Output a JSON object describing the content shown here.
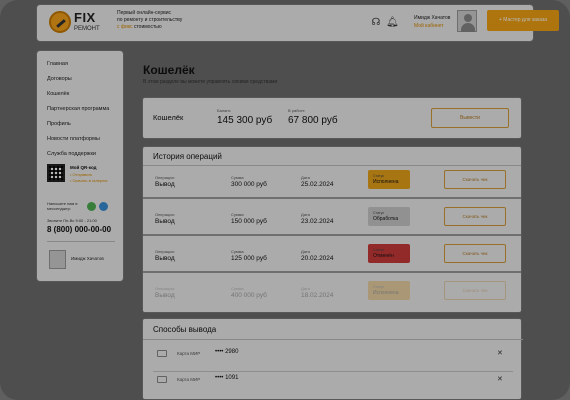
{
  "header": {
    "logo_top": "FIX",
    "logo_bottom": "РЕМОНТ",
    "tagline_line1": "Первый онлайн-сервис",
    "tagline_line2": "по ремонту и строительству",
    "tagline_accent": "с фикс",
    "tagline_rest": "стоимостью",
    "user_name": "Имидж Хачатов",
    "user_role": "Мой кабинет",
    "action_button": "+ Мастер для заказа"
  },
  "sidebar": {
    "items": [
      {
        "label": "Главная"
      },
      {
        "label": "Договоры"
      },
      {
        "label": "Кошелёк"
      },
      {
        "label": "Партнерская программа"
      },
      {
        "label": "Профиль"
      },
      {
        "label": "Новости платформы"
      },
      {
        "label": "Служба поддержки"
      }
    ],
    "qr_title": "Мой QR-код",
    "qr_link1": "• Отправить",
    "qr_link2": "• Скачать в галерею",
    "messengers_label": "Напишите нам в мессенджер:",
    "hours": "Звоните Пн-Вс 9:00 - 21:00",
    "phone": "8 (800) 000-00-00",
    "user_name": "Имидж Хачатов"
  },
  "page": {
    "title": "Кошелёк",
    "subtitle": "В этом разделе вы можете управлять своими средствами"
  },
  "wallet": {
    "title": "Кошелёк",
    "balance_label": "Баланс",
    "balance": "145 300 руб",
    "in_work_label": "В работе",
    "in_work": "67 800 руб",
    "button": "Вывести"
  },
  "operations": {
    "title": "История операций",
    "rows": [
      {
        "op_label": "Операция:",
        "op": "Вывод",
        "sum_label": "Сумма",
        "sum": "300 000 руб",
        "date_label": "Дата",
        "date": "25.02.2024",
        "status_label": "Статус",
        "status": "Исполнена",
        "button": "Скачать чек"
      },
      {
        "op_label": "Операция:",
        "op": "Вывод",
        "sum_label": "Сумма",
        "sum": "150 000 руб",
        "date_label": "Дата",
        "date": "23.02.2024",
        "status_label": "Статус",
        "status": "Обработка",
        "button": "Скачать чек"
      },
      {
        "op_label": "Операция:",
        "op": "Вывод",
        "sum_label": "Сумма",
        "sum": "125 000 руб",
        "date_label": "Дата",
        "date": "20.02.2024",
        "status_label": "Статус",
        "status": "Отменён",
        "button": "Скачать чек"
      },
      {
        "op_label": "Операция:",
        "op": "Вывод",
        "sum_label": "Сумма",
        "sum": "400 000 руб",
        "date_label": "Дата",
        "date": "18.02.2024",
        "status_label": "Статус",
        "status": "Исполнена",
        "button": "Скачать чек"
      }
    ]
  },
  "methods": {
    "title": "Способы вывода",
    "cards": [
      {
        "label": "Карта МИР",
        "number": "•••• 2980",
        "remove": "✕"
      },
      {
        "label": "Карта МИР",
        "number": "•••• 1091",
        "remove": "✕"
      }
    ]
  },
  "colors": {
    "accent": "#f2a112",
    "status_done": "#e8a21a",
    "status_processing": "#c9c9c9",
    "status_cancelled": "#cc3b3b"
  }
}
